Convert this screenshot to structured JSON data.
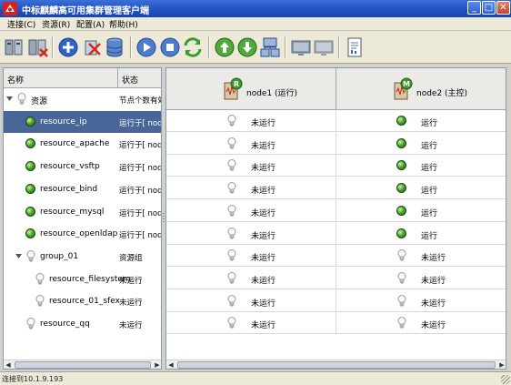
{
  "window": {
    "title": "中标麒麟高可用集群管理客户端"
  },
  "menu": [
    "连接(C)",
    "资源(R)",
    "配置(A)",
    "帮助(H)"
  ],
  "toolbar": [
    "connect-icon",
    "disconnect-icon",
    "add-icon",
    "delete-icon",
    "database-icon",
    "start-icon",
    "stop-icon",
    "refresh-icon",
    "up-arrow-icon",
    "down-arrow-icon",
    "cluster-icon",
    "monitor-icon",
    "monitor-disabled-icon",
    "report-icon"
  ],
  "tree": {
    "headers": {
      "name": "名称",
      "status": "状态"
    },
    "rows": [
      {
        "name": "资源",
        "status": "节点个数有效",
        "icon": "bulb",
        "level": 0,
        "expander": true,
        "selected": false
      },
      {
        "name": "resource_ip",
        "status": "运行于[ node",
        "icon": "green",
        "level": 1,
        "selected": true
      },
      {
        "name": "resource_apache",
        "status": "运行于[ node",
        "icon": "green",
        "level": 1,
        "selected": false
      },
      {
        "name": "resource_vsftp",
        "status": "运行于[ node",
        "icon": "green",
        "level": 1,
        "selected": false
      },
      {
        "name": "resource_bind",
        "status": "运行于[ node",
        "icon": "green",
        "level": 1,
        "selected": false
      },
      {
        "name": "resource_mysql",
        "status": "运行于[ node",
        "icon": "green",
        "level": 1,
        "selected": false
      },
      {
        "name": "resource_openldap",
        "status": "运行于[ node",
        "icon": "green",
        "level": 1,
        "selected": false
      },
      {
        "name": "group_01",
        "status": "资源组",
        "icon": "bulb",
        "level": 1,
        "expander": true,
        "selected": false
      },
      {
        "name": "resource_filesystem",
        "status": "未运行",
        "icon": "bulb",
        "level": 2,
        "selected": false
      },
      {
        "name": "resource_01_sfex",
        "status": "未运行",
        "icon": "bulb",
        "level": 2,
        "selected": false
      },
      {
        "name": "resource_qq",
        "status": "未运行",
        "icon": "bulb",
        "level": 1,
        "selected": false
      }
    ]
  },
  "nodes": [
    {
      "label": "node1 (运行)",
      "badge": "R"
    },
    {
      "label": "node2 (主控)",
      "badge": "M"
    }
  ],
  "grid": [
    [
      {
        "icon": "bulb",
        "text": "未运行"
      },
      {
        "icon": "green",
        "text": "运行"
      }
    ],
    [
      {
        "icon": "bulb",
        "text": "未运行"
      },
      {
        "icon": "green",
        "text": "运行"
      }
    ],
    [
      {
        "icon": "bulb",
        "text": "未运行"
      },
      {
        "icon": "green",
        "text": "运行"
      }
    ],
    [
      {
        "icon": "bulb",
        "text": "未运行"
      },
      {
        "icon": "green",
        "text": "运行"
      }
    ],
    [
      {
        "icon": "bulb",
        "text": "未运行"
      },
      {
        "icon": "green",
        "text": "运行"
      }
    ],
    [
      {
        "icon": "bulb",
        "text": "未运行"
      },
      {
        "icon": "green",
        "text": "运行"
      }
    ],
    [
      {
        "icon": "bulb",
        "text": "未运行"
      },
      {
        "icon": "bulb",
        "text": "未运行"
      }
    ],
    [
      {
        "icon": "bulb",
        "text": "未运行"
      },
      {
        "icon": "bulb",
        "text": "未运行"
      }
    ],
    [
      {
        "icon": "bulb",
        "text": "未运行"
      },
      {
        "icon": "bulb",
        "text": "未运行"
      }
    ],
    [
      {
        "icon": "bulb",
        "text": "未运行"
      },
      {
        "icon": "bulb",
        "text": "未运行"
      }
    ]
  ],
  "status_bar": {
    "text": "连接到10.1.9.193"
  },
  "colors": {
    "selected": "#4a6698",
    "running": "#4fa82b",
    "title": "#1f4fc0"
  }
}
